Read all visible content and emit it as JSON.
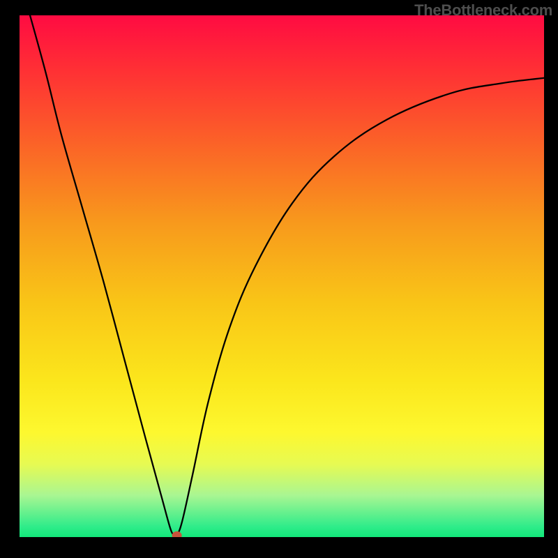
{
  "watermark": "TheBottleneck.com",
  "chart_data": {
    "type": "line",
    "title": "",
    "xlabel": "",
    "ylabel": "",
    "xlim": [
      0,
      1
    ],
    "ylim": [
      0,
      1
    ],
    "background_gradient": {
      "stops": [
        {
          "offset": 0.0,
          "color": "#ff0b42"
        },
        {
          "offset": 0.1,
          "color": "#ff2e35"
        },
        {
          "offset": 0.25,
          "color": "#fb6427"
        },
        {
          "offset": 0.4,
          "color": "#f89a1c"
        },
        {
          "offset": 0.55,
          "color": "#f9c517"
        },
        {
          "offset": 0.7,
          "color": "#fbe61c"
        },
        {
          "offset": 0.8,
          "color": "#fdf82f"
        },
        {
          "offset": 0.86,
          "color": "#e7fa52"
        },
        {
          "offset": 0.92,
          "color": "#a9f692"
        },
        {
          "offset": 0.98,
          "color": "#2fec8a"
        },
        {
          "offset": 1.0,
          "color": "#12e87a"
        }
      ]
    },
    "series": [
      {
        "name": "curve",
        "x": [
          0.02,
          0.05,
          0.08,
          0.12,
          0.16,
          0.2,
          0.24,
          0.27,
          0.288,
          0.295,
          0.3,
          0.31,
          0.33,
          0.36,
          0.4,
          0.45,
          0.52,
          0.6,
          0.7,
          0.82,
          0.92,
          1.0
        ],
        "values": [
          1.0,
          0.89,
          0.77,
          0.63,
          0.49,
          0.34,
          0.19,
          0.08,
          0.015,
          0.006,
          0.004,
          0.03,
          0.12,
          0.26,
          0.4,
          0.52,
          0.64,
          0.73,
          0.8,
          0.85,
          0.87,
          0.88
        ]
      }
    ],
    "marker": {
      "x": 0.3,
      "y": 0.003,
      "color": "#c8533c"
    }
  }
}
